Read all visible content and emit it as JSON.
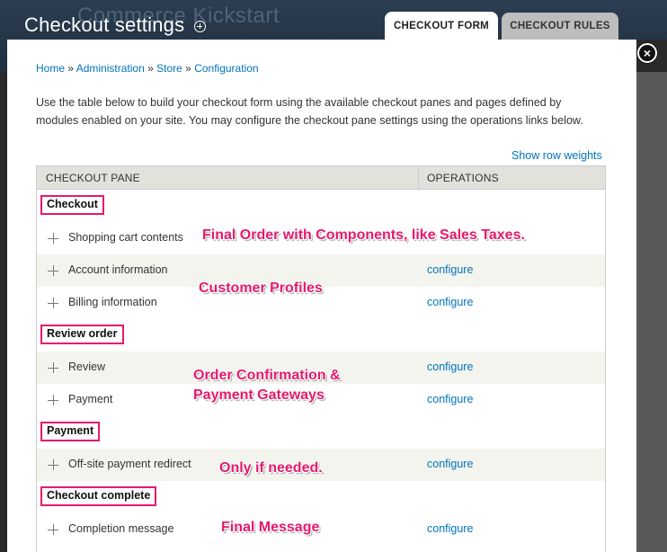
{
  "background": {
    "brand": "Commerce Kickstart"
  },
  "overlay": {
    "title": "Checkout settings",
    "tabs": [
      {
        "label": "CHECKOUT FORM",
        "active": true
      },
      {
        "label": "CHECKOUT RULES",
        "active": false
      }
    ],
    "close_label": "×"
  },
  "breadcrumb": {
    "items": [
      "Home",
      "Administration",
      "Store",
      "Configuration"
    ],
    "separator": "»"
  },
  "intro_text": "Use the table below to build your checkout form using the available checkout panes and pages defined by modules enabled on your site. You may configure the checkout pane settings using the operations links below.",
  "show_row_weights": "Show row weights",
  "table": {
    "headers": [
      "CHECKOUT PANE",
      "OPERATIONS"
    ],
    "regions": [
      {
        "label": "Checkout"
      },
      {
        "label": "Review order"
      },
      {
        "label": "Payment"
      },
      {
        "label": "Checkout complete"
      }
    ],
    "rows": [
      {
        "name": "Shopping cart contents",
        "operation": ""
      },
      {
        "name": "Account information",
        "operation": "configure"
      },
      {
        "name": "Billing information",
        "operation": "configure"
      },
      {
        "name": "Review",
        "operation": "configure"
      },
      {
        "name": "Payment",
        "operation": "configure"
      },
      {
        "name": "Off-site payment redirect",
        "operation": "configure"
      },
      {
        "name": "Completion message",
        "operation": "configure"
      }
    ]
  },
  "annotations": [
    "Final Order with Components, like Sales Taxes.",
    "Customer Profiles",
    "Order Confirmation &",
    "Payment Gateways",
    "Only if needed.",
    "Final Message"
  ],
  "colors": {
    "accent_annotation": "#e5196d",
    "link": "#0074bd",
    "header_bg": "#2b3e52"
  }
}
